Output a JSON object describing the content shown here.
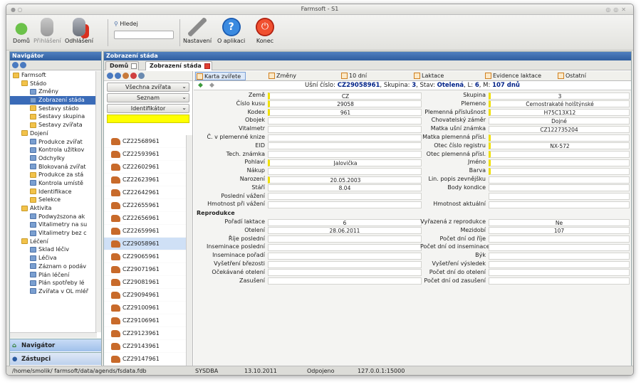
{
  "window": {
    "title": "Farmsoft - S1"
  },
  "toolbar": {
    "home": "Domů",
    "login": "Přihlášení",
    "logout": "Odhlášení",
    "search": "Hledej",
    "settings": "Nastavení",
    "about": "O aplikaci",
    "exit": "Konec"
  },
  "navigator": {
    "title": "Navigátor",
    "tree": [
      {
        "label": "Farmsoft",
        "lvl": 0,
        "t": "fold"
      },
      {
        "label": "Stádo",
        "lvl": 1,
        "t": "fold"
      },
      {
        "label": "Změny",
        "lvl": 2,
        "t": "doc"
      },
      {
        "label": "Zobrazení stáda",
        "lvl": 2,
        "t": "doc",
        "sel": true
      },
      {
        "label": "Sestavy stádo",
        "lvl": 2,
        "t": "fold"
      },
      {
        "label": "Sestavy skupina",
        "lvl": 2,
        "t": "fold"
      },
      {
        "label": "Sestavy zvířata",
        "lvl": 2,
        "t": "fold"
      },
      {
        "label": "Dojení",
        "lvl": 1,
        "t": "fold"
      },
      {
        "label": "Produkce zvířat",
        "lvl": 2,
        "t": "doc"
      },
      {
        "label": "Kontrola užitkov",
        "lvl": 2,
        "t": "doc"
      },
      {
        "label": "Odchylky",
        "lvl": 2,
        "t": "doc"
      },
      {
        "label": "Blokovaná zvířat",
        "lvl": 2,
        "t": "doc"
      },
      {
        "label": "Produkce za stá",
        "lvl": 2,
        "t": "fold"
      },
      {
        "label": "Kontrola umístě",
        "lvl": 2,
        "t": "doc"
      },
      {
        "label": "Identifikace",
        "lvl": 2,
        "t": "fold"
      },
      {
        "label": "Selekce",
        "lvl": 2,
        "t": "fold"
      },
      {
        "label": "Aktivita",
        "lvl": 1,
        "t": "fold"
      },
      {
        "label": "Podwyższona ak",
        "lvl": 2,
        "t": "doc"
      },
      {
        "label": "Vitalimetry na su",
        "lvl": 2,
        "t": "doc"
      },
      {
        "label": "Vitalimetry bez c",
        "lvl": 2,
        "t": "doc"
      },
      {
        "label": "Léčení",
        "lvl": 1,
        "t": "fold"
      },
      {
        "label": "Sklad léčiv",
        "lvl": 2,
        "t": "doc"
      },
      {
        "label": "Léčiva",
        "lvl": 2,
        "t": "doc"
      },
      {
        "label": "Záznam o podáv",
        "lvl": 2,
        "t": "doc"
      },
      {
        "label": "Plán léčení",
        "lvl": 2,
        "t": "doc"
      },
      {
        "label": "Plán spotřeby lé",
        "lvl": 2,
        "t": "doc"
      },
      {
        "label": "Zvířata v OL mléř",
        "lvl": 2,
        "t": "doc"
      }
    ],
    "acc_nav": "Navigátor",
    "acc_rep": "Zástupci"
  },
  "main": {
    "title": "Zobrazení stáda",
    "tabs": [
      "Domů",
      "Zobrazení stáda"
    ],
    "filters": [
      "Všechna zvířata",
      "Seznam",
      "Identifikátor"
    ],
    "animals": [
      "CZ22568961",
      "CZ22593961",
      "CZ22602961",
      "CZ22623961",
      "CZ22642961",
      "CZ22655961",
      "CZ22656961",
      "CZ22659961",
      "CZ29058961",
      "CZ29065961",
      "CZ29071961",
      "CZ29081961",
      "CZ29094961",
      "CZ29100961",
      "CZ29106961",
      "CZ29123961",
      "CZ29143961",
      "CZ29147961"
    ],
    "selected_animal": "CZ29058961"
  },
  "detail": {
    "tabs": [
      "Karta zvířete",
      "Změny",
      "10 dní",
      "Laktace",
      "Evidence laktace",
      "Ostatní"
    ],
    "info": {
      "p1": "Ušní číslo: ",
      "ear": "CZ29058961",
      "p2": ", Skupina: ",
      "group": "3",
      "p3": ", Stav: ",
      "state": "Otelená",
      "p4": ", L: ",
      "lact": "6",
      "p5": ", M: ",
      "days": "107 dnů"
    },
    "left": [
      {
        "l": "Země",
        "v": "CZ",
        "r": 1
      },
      {
        "l": "Číslo kusu",
        "v": "29058",
        "r": 1
      },
      {
        "l": "Kodex",
        "v": "961",
        "r": 1
      },
      {
        "l": "Obojek",
        "v": ""
      },
      {
        "l": "Vitalmetr",
        "v": ""
      },
      {
        "l": "Č. v plemenné knize",
        "v": ""
      },
      {
        "l": "EID",
        "v": ""
      },
      {
        "l": "Tech. známka",
        "v": ""
      },
      {
        "l": "Pohlaví",
        "v": "Jalovička",
        "r": 1
      },
      {
        "l": "Nákup",
        "v": ""
      },
      {
        "l": "Narození",
        "v": "20.05.2003",
        "r": 1
      },
      {
        "l": "Stáří",
        "v": "8.04"
      },
      {
        "l": "Poslední vážení",
        "v": ""
      },
      {
        "l": "Hmotnost při vážení",
        "v": ""
      }
    ],
    "right": [
      {
        "l": "Skupina",
        "v": "3",
        "r": 1
      },
      {
        "l": "Plemeno",
        "v": "Černostrakaté holštýnské",
        "r": 1
      },
      {
        "l": "Plemenná příslušnost",
        "v": "H75C13X12",
        "r": 1
      },
      {
        "l": "Chovatelský záměr",
        "v": "Dojné"
      },
      {
        "l": "Matka ušní známka",
        "v": "CZ122735204"
      },
      {
        "l": "Matka plemenná přísl.",
        "v": "",
        "r": 1
      },
      {
        "l": "Otec číslo registru",
        "v": "NX-572",
        "r": 1
      },
      {
        "l": "Otec plemenná přísl.",
        "v": "",
        "r": 1
      },
      {
        "l": "Jméno",
        "v": "",
        "r": 1
      },
      {
        "l": "Barva",
        "v": "",
        "r": 1
      },
      {
        "l": "Lin. popis zevnějšku",
        "v": ""
      },
      {
        "l": "Body kondice",
        "v": ""
      },
      {
        "l": "",
        "v": ""
      },
      {
        "l": "Hmotnost aktuální",
        "v": ""
      }
    ],
    "section": "Reprodukce",
    "left2": [
      {
        "l": "Pořadí laktace",
        "v": "6"
      },
      {
        "l": "Otelení",
        "v": "28.06.2011"
      },
      {
        "l": "Říje poslední",
        "v": ""
      },
      {
        "l": "Inseminace poslední",
        "v": ""
      },
      {
        "l": "Inseminace pořadí",
        "v": ""
      },
      {
        "l": "Vyšetření březosti",
        "v": ""
      },
      {
        "l": "Očekávané otelení",
        "v": ""
      },
      {
        "l": "Zasušení",
        "v": ""
      }
    ],
    "right2": [
      {
        "l": "Vyřazená z reprodukce",
        "v": "Ne"
      },
      {
        "l": "Mezidobí",
        "v": "107"
      },
      {
        "l": "Počet dní od říje",
        "v": ""
      },
      {
        "l": "Počet dní od inseminace",
        "v": ""
      },
      {
        "l": "Býk",
        "v": ""
      },
      {
        "l": "Vyšetření výsledek",
        "v": ""
      },
      {
        "l": "Počet dní do otelení",
        "v": ""
      },
      {
        "l": "Počet dní od zasušení",
        "v": ""
      }
    ]
  },
  "status": {
    "path": "/home/smolik/ farmsoft/data/agends/fsdata.fdb",
    "user": "SYSDBA",
    "date": "13.10.2011",
    "conn": "Odpojeno",
    "host": "127.0.0.1:15000"
  },
  "colors": {
    "accent": "#2f5e9f",
    "required": "#f0e000",
    "search": "#ffff00"
  }
}
